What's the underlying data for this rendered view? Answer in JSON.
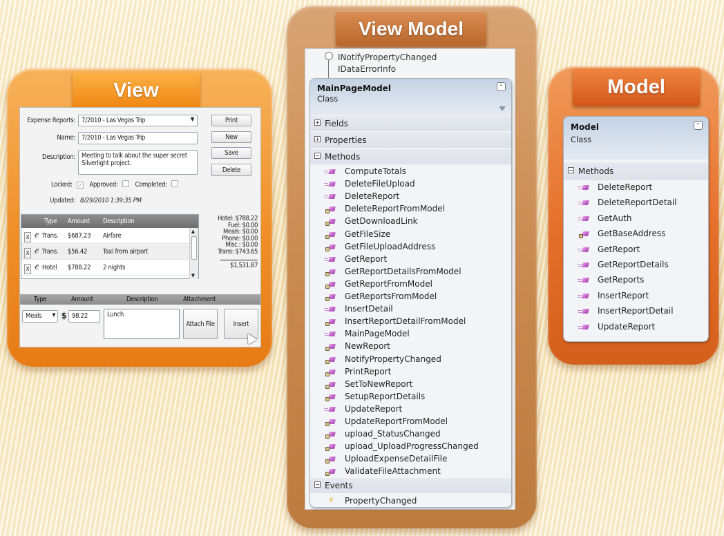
{
  "view": {
    "tab_label": "View",
    "expense_reports_label": "Expense Reports:",
    "expense_reports_value": "7/2010 - Las Vegas Trip",
    "name_label": "Name:",
    "name_value": "7/2010 - Las Vegas Trip",
    "description_label": "Description:",
    "description_value_line1": "Meeting to talk about the super secret",
    "description_value_line2": "Silverlight project.",
    "locked_label": "Locked:",
    "approved_label": "Approved:",
    "completed_label": "Completed:",
    "updated_label": "Updated:",
    "updated_value": "8/29/2010 1:39:35 PM",
    "buttons": {
      "print": "Print",
      "new": "New",
      "save": "Save",
      "delete": "Delete",
      "attach_file": "Attach File",
      "insert": "Insert"
    },
    "grid": {
      "columns": [
        "Type",
        "Amount",
        "Description"
      ],
      "rows": [
        {
          "x": "X",
          "type": "Trans.",
          "amount": "$687.23",
          "description": "Airfare"
        },
        {
          "x": "X",
          "type": "Trans.",
          "amount": "$56.42",
          "description": "Taxi from airport"
        },
        {
          "x": "X",
          "type": "Hotel",
          "amount": "$788.22",
          "description": "2 nights"
        }
      ]
    },
    "totals": {
      "hotel": "Hotel: $788.22",
      "fuel": "Fuel: $0.00",
      "meals": "Meals: $0.00",
      "phone": "Phone: $0.00",
      "misc": "Misc.: $0.00",
      "trans": "Trans: $743.65",
      "grand": "$1,531.87"
    },
    "entry": {
      "columns": [
        "Type",
        "Amount",
        "Description",
        "Attachment"
      ],
      "type_value": "Meals",
      "currency": "$",
      "amount_value": "98.22",
      "description_value": "Lunch"
    }
  },
  "view_model": {
    "tab_label": "View Model",
    "interfaces": [
      "INotifyPropertyChanged",
      "IDataErrorInfo"
    ],
    "class_name": "MainPageModel",
    "class_type": "Class",
    "sections": {
      "fields": "Fields",
      "properties": "Properties",
      "methods": "Methods",
      "events": "Events"
    },
    "methods": [
      "ComputeTotals",
      "DeleteFileUpload",
      "DeleteReport",
      "DeleteReportFromModel",
      "GetDownloadLink",
      "GetFileSize",
      "GetFileUploadAddress",
      "GetReport",
      "GetReportDetailsFromModel",
      "GetReportFromModel",
      "GetReportsFromModel",
      "InsertDetail",
      "InsertReportDetailFromModel",
      "MainPageModel",
      "NewReport",
      "NotifyPropertyChanged",
      "PrintReport",
      "SetToNewReport",
      "SetupReportDetails",
      "UpdateReport",
      "UpdateReportFromModel",
      "upload_StatusChanged",
      "upload_UploadProgressChanged",
      "UploadExpenseDetailFile",
      "ValidateFileAttachment"
    ],
    "events": [
      "PropertyChanged"
    ]
  },
  "model": {
    "tab_label": "Model",
    "class_name": "Model",
    "class_type": "Class",
    "methods_label": "Methods",
    "methods": [
      "DeleteReport",
      "DeleteReportDetail",
      "GetAuth",
      "GetBaseAddress",
      "GetReport",
      "GetReportDetails",
      "GetReports",
      "InsertReport",
      "InsertReportDetail",
      "UpdateReport"
    ]
  },
  "colors": {
    "view_frame": "#ef8f28",
    "view_model_frame": "#c98a4f",
    "model_frame": "#e46f2a",
    "method_icon": "#a53fb0"
  }
}
